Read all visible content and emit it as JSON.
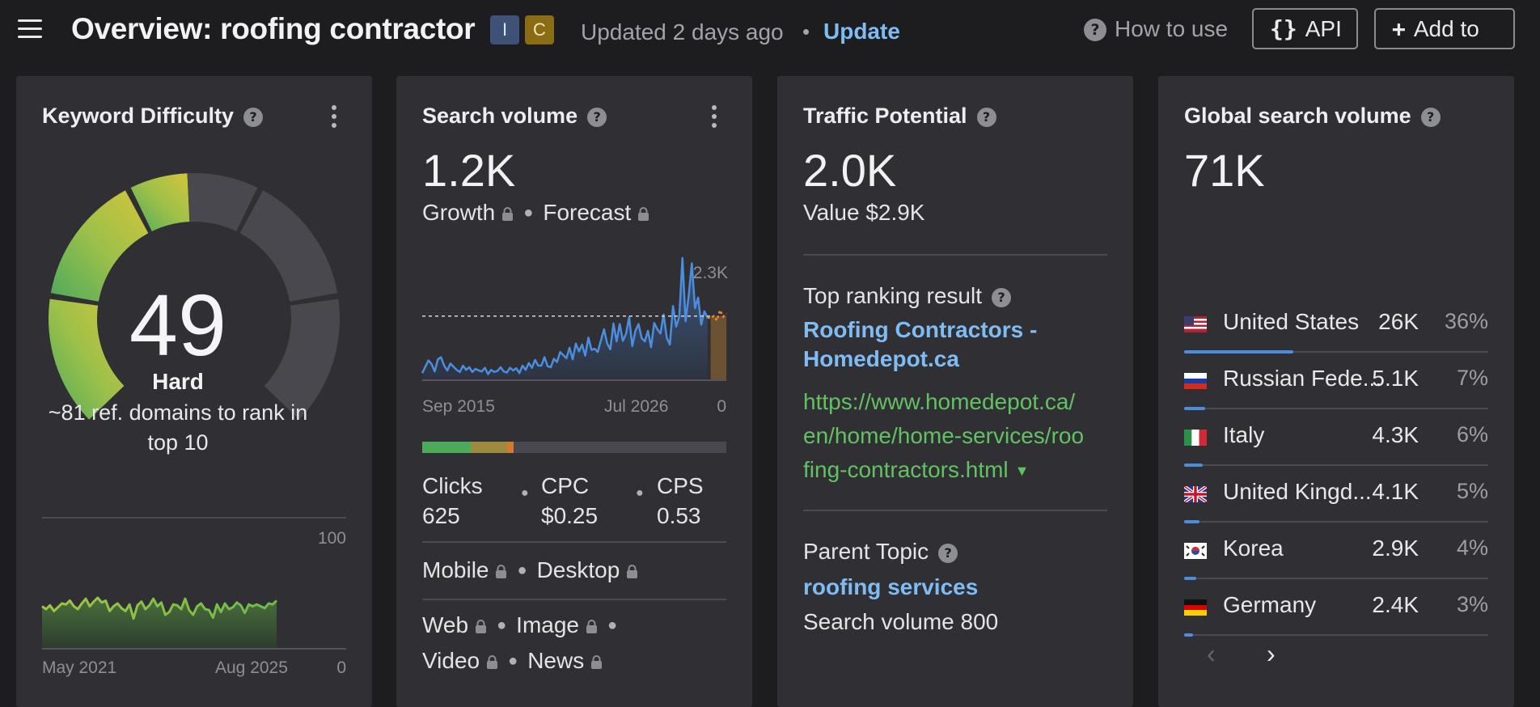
{
  "header": {
    "title": "Overview: roofing contractor",
    "badges": [
      "I",
      "C"
    ],
    "updated": "Updated 2 days ago",
    "update_link": "Update",
    "how_to_use": "How to use",
    "api_label": "API",
    "add_to_label": "Add to",
    "api_icon": "{}",
    "add_icon": "+"
  },
  "keyword_difficulty": {
    "title": "Keyword Difficulty",
    "value": "49",
    "value_num": 49,
    "label": "Hard",
    "description": "~81 ref. domains to rank in top 10",
    "chart_max": "100",
    "chart_min": "0",
    "chart_start": "May 2021",
    "chart_end": "Aug 2025",
    "gauge_colors": [
      "#4caa5c",
      "#9cc04a",
      "#d4c53a"
    ]
  },
  "search_volume": {
    "title": "Search volume",
    "value": "1.2K",
    "growth": "Growth",
    "forecast": "Forecast",
    "chart_max": "2.3K",
    "chart_min": "0",
    "chart_start": "Sep 2015",
    "chart_end": "Jul 2026",
    "intent_bar": [
      {
        "color": "#4caa5c",
        "share": 0.16
      },
      {
        "color": "#9c8a3e",
        "share": 0.12
      },
      {
        "color": "#d47a30",
        "share": 0.02
      }
    ],
    "clicks_label": "Clicks",
    "clicks_value": "625",
    "cpc_label": "CPC",
    "cpc_value": "$0.25",
    "cps_label": "CPS",
    "cps_value": "0.53",
    "mobile": "Mobile",
    "desktop": "Desktop",
    "web": "Web",
    "image": "Image",
    "video": "Video",
    "news": "News"
  },
  "traffic_potential": {
    "title": "Traffic Potential",
    "value": "2.0K",
    "value_text": "Value $2.9K",
    "top_result_label": "Top ranking result",
    "top_result_title_1": "Roofing Contractors -",
    "top_result_title_2": "Homedepot.ca",
    "top_result_url_1": "https://www.homedepot.ca/",
    "top_result_url_2": "en/home/home-services/roo",
    "top_result_url_3": "fing-contractors.html",
    "parent_topic_label": "Parent Topic",
    "parent_topic": "roofing services",
    "parent_volume": "Search volume 800"
  },
  "global_volume": {
    "title": "Global search volume",
    "value": "71K",
    "countries": [
      {
        "name": "United States",
        "volume": "26K",
        "pct": "36%",
        "share": 0.36,
        "flag": "us-flag-icon"
      },
      {
        "name": "Russian Fede...",
        "volume": "5.1K",
        "pct": "7%",
        "share": 0.07,
        "flag": "ru-flag-icon"
      },
      {
        "name": "Italy",
        "volume": "4.3K",
        "pct": "6%",
        "share": 0.06,
        "flag": "it-flag-icon"
      },
      {
        "name": "United Kingd...",
        "volume": "4.1K",
        "pct": "5%",
        "share": 0.05,
        "flag": "uk-flag-icon"
      },
      {
        "name": "Korea",
        "volume": "2.9K",
        "pct": "4%",
        "share": 0.04,
        "flag": "kr-flag-icon"
      },
      {
        "name": "Germany",
        "volume": "2.4K",
        "pct": "3%",
        "share": 0.03,
        "flag": "de-flag-icon"
      }
    ],
    "prev_icon": "‹",
    "next_icon": "›"
  },
  "chart_data": [
    {
      "type": "area",
      "xlabel": "",
      "ylabel": "",
      "x_range": [
        "May 2021",
        "Aug 2025"
      ],
      "ylim": [
        0,
        100
      ],
      "series": [
        {
          "values": [
            44,
            41,
            45,
            39,
            43,
            47,
            46,
            50,
            44,
            41,
            47,
            52,
            44,
            49,
            53,
            48,
            50,
            39,
            44,
            47,
            42,
            39,
            46,
            31,
            45,
            49,
            41,
            45,
            52,
            44,
            48,
            35,
            38,
            46,
            45,
            41,
            52,
            40,
            35,
            44,
            47,
            41,
            40,
            32,
            46,
            38,
            47,
            41,
            43,
            48,
            45,
            37,
            46,
            44,
            46,
            44,
            42,
            47,
            46,
            50
          ]
        }
      ]
    },
    {
      "type": "area",
      "xlabel": "",
      "ylabel": "",
      "x_range": [
        "Sep 2015",
        "Jul 2026"
      ],
      "ylim": [
        0,
        2300
      ],
      "reference_line": 1200,
      "series": [
        {
          "values": [
            120,
            240,
            360,
            290,
            150,
            380,
            420,
            260,
            170,
            300,
            240,
            180,
            140,
            260,
            180,
            230,
            140,
            200,
            170,
            150,
            220,
            100,
            180,
            140,
            160,
            230,
            150,
            130,
            220,
            170,
            210,
            120,
            260,
            180,
            310,
            220,
            370,
            260,
            260,
            420,
            250,
            230,
            390,
            330,
            520,
            460,
            400,
            600,
            380,
            680,
            530,
            660,
            450,
            790,
            560,
            580,
            520,
            740,
            950,
            680,
            570,
            1060,
            720,
            1050,
            730,
            860,
            1180,
            630,
            920,
            1050,
            780,
            720,
            920,
            610,
            1070,
            950,
            870,
            1230,
            790,
            660,
            1390,
            1000,
            1190,
            2300,
            1100,
            1590,
            2200,
            1350,
            1550,
            1040,
            1290,
            1170
          ]
        },
        {
          "name": "Forecast",
          "values": [
            1160,
            1200,
            1120,
            1310,
            1190,
            1250
          ]
        }
      ]
    }
  ]
}
